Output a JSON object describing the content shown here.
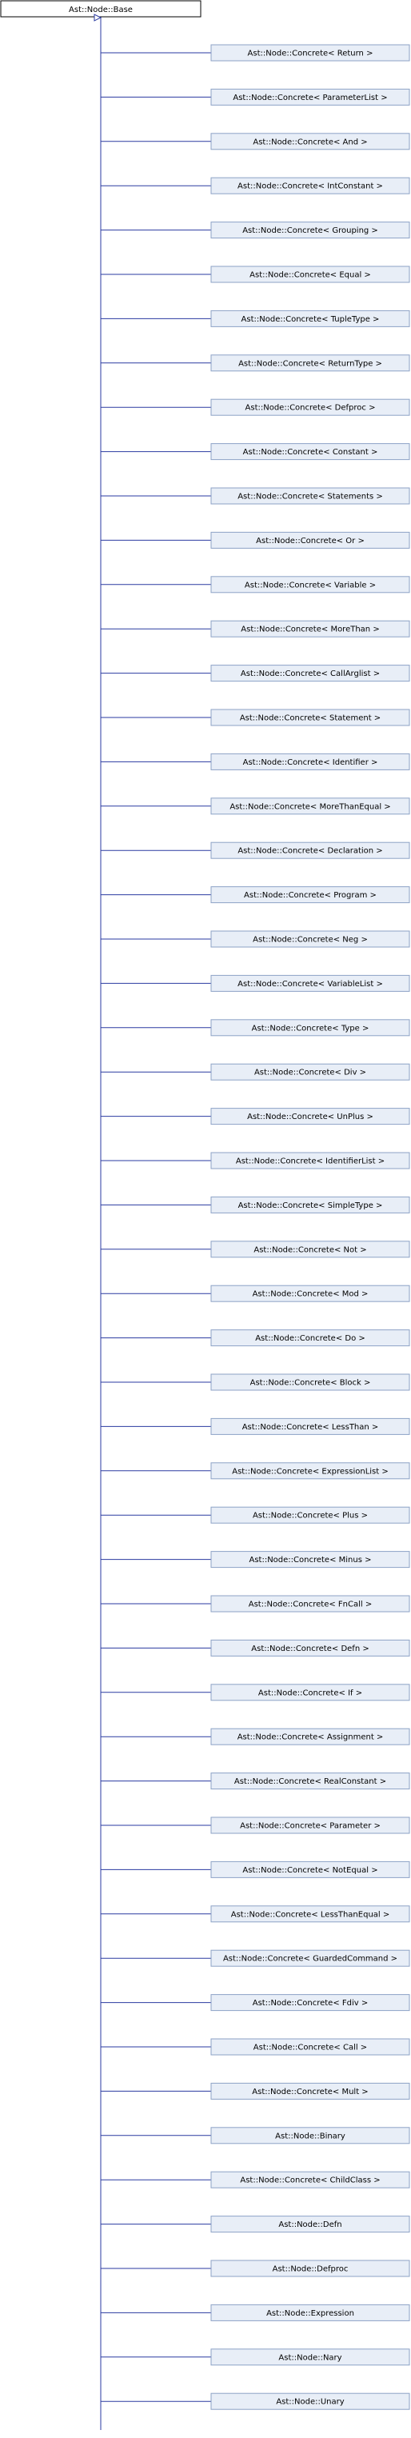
{
  "base_class": "Ast::Node::Base",
  "derived_classes": [
    "Ast::Node::Concrete< Return >",
    "Ast::Node::Concrete< ParameterList >",
    "Ast::Node::Concrete< And >",
    "Ast::Node::Concrete< IntConstant >",
    "Ast::Node::Concrete< Grouping >",
    "Ast::Node::Concrete< Equal >",
    "Ast::Node::Concrete< TupleType >",
    "Ast::Node::Concrete< ReturnType >",
    "Ast::Node::Concrete< Defproc >",
    "Ast::Node::Concrete< Constant >",
    "Ast::Node::Concrete< Statements >",
    "Ast::Node::Concrete< Or >",
    "Ast::Node::Concrete< Variable >",
    "Ast::Node::Concrete< MoreThan >",
    "Ast::Node::Concrete< CallArglist >",
    "Ast::Node::Concrete< Statement >",
    "Ast::Node::Concrete< Identifier >",
    "Ast::Node::Concrete< MoreThanEqual >",
    "Ast::Node::Concrete< Declaration >",
    "Ast::Node::Concrete< Program >",
    "Ast::Node::Concrete< Neg >",
    "Ast::Node::Concrete< VariableList >",
    "Ast::Node::Concrete< Type >",
    "Ast::Node::Concrete< Div >",
    "Ast::Node::Concrete< UnPlus >",
    "Ast::Node::Concrete< IdentifierList >",
    "Ast::Node::Concrete< SimpleType >",
    "Ast::Node::Concrete< Not >",
    "Ast::Node::Concrete< Mod >",
    "Ast::Node::Concrete< Do >",
    "Ast::Node::Concrete< Block >",
    "Ast::Node::Concrete< LessThan >",
    "Ast::Node::Concrete< ExpressionList >",
    "Ast::Node::Concrete< Plus >",
    "Ast::Node::Concrete< Minus >",
    "Ast::Node::Concrete< FnCall >",
    "Ast::Node::Concrete< Defn >",
    "Ast::Node::Concrete< If >",
    "Ast::Node::Concrete< Assignment >",
    "Ast::Node::Concrete< RealConstant >",
    "Ast::Node::Concrete< Parameter >",
    "Ast::Node::Concrete< NotEqual >",
    "Ast::Node::Concrete< LessThanEqual >",
    "Ast::Node::Concrete< GuardedCommand >",
    "Ast::Node::Concrete< Fdiv >",
    "Ast::Node::Concrete< Call >",
    "Ast::Node::Concrete< Mult >",
    "Ast::Node::Binary",
    "Ast::Node::Concrete< ChildClass >",
    "Ast::Node::Defn",
    "Ast::Node::Defproc",
    "Ast::Node::Expression",
    "Ast::Node::Nary",
    "Ast::Node::Unary"
  ],
  "colors": {
    "base_fill": "#ffffff",
    "base_stroke": "#000000",
    "node_fill": "#e8eef7",
    "node_stroke": "#8da2c6",
    "edge": "#2a3aa0",
    "text": "#000000"
  }
}
